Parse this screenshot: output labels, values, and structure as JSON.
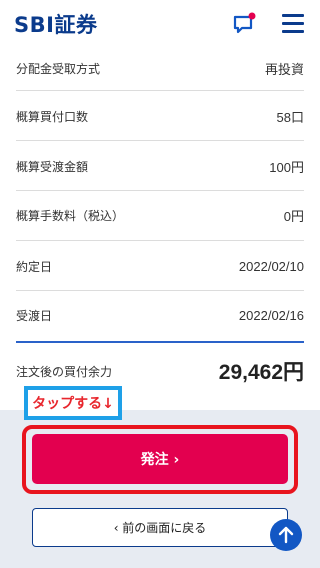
{
  "header": {
    "logo": "SBI証券",
    "chat_icon": "chat-bubble-icon",
    "menu_icon": "hamburger-menu-icon",
    "notification_color": "#e3004f",
    "brand_color": "#0b3b8c"
  },
  "details": [
    {
      "label": "分配金受取方式",
      "value": "再投資"
    },
    {
      "label": "概算買付口数",
      "value": "58口"
    },
    {
      "label": "概算受渡金額",
      "value": "100円"
    },
    {
      "label": "概算手数料（税込）",
      "value": "0円"
    },
    {
      "label": "約定日",
      "value": "2022/02/10"
    },
    {
      "label": "受渡日",
      "value": "2022/02/16"
    }
  ],
  "summary": {
    "label": "注文後の買付余力",
    "value": "29,462円"
  },
  "annotation": {
    "text": "タップする↓",
    "border_color": "#1ea0e8",
    "text_color": "#e8262d"
  },
  "actions": {
    "order_label": "発注 ›",
    "order_color": "#e3004f",
    "back_label": "‹ 前の画面に戻る",
    "scroll_top_icon": "arrow-up-icon"
  }
}
